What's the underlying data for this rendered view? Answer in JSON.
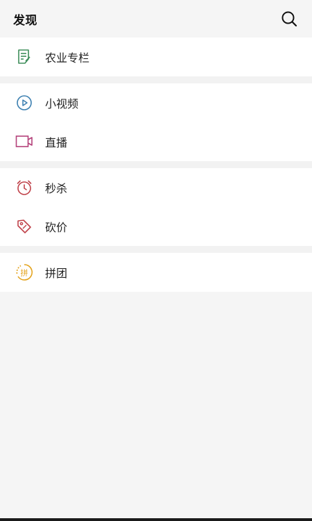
{
  "header": {
    "title": "发现",
    "search_icon": "search-icon"
  },
  "groups": [
    {
      "items": [
        {
          "label": "农业专栏",
          "icon": "article-icon",
          "color": "#3e8e5a"
        }
      ]
    },
    {
      "items": [
        {
          "label": "小视频",
          "icon": "play-circle-icon",
          "color": "#3b7fb0"
        },
        {
          "label": "直播",
          "icon": "video-camera-icon",
          "color": "#b4417a"
        }
      ]
    },
    {
      "items": [
        {
          "label": "秒杀",
          "icon": "alarm-clock-icon",
          "color": "#c0424a"
        },
        {
          "label": "砍价",
          "icon": "price-tag-icon",
          "color": "#c0424a"
        }
      ]
    },
    {
      "items": [
        {
          "label": "拼团",
          "icon": "group-buy-icon",
          "icon_text": "拼",
          "color": "#e3a21a"
        }
      ]
    }
  ]
}
